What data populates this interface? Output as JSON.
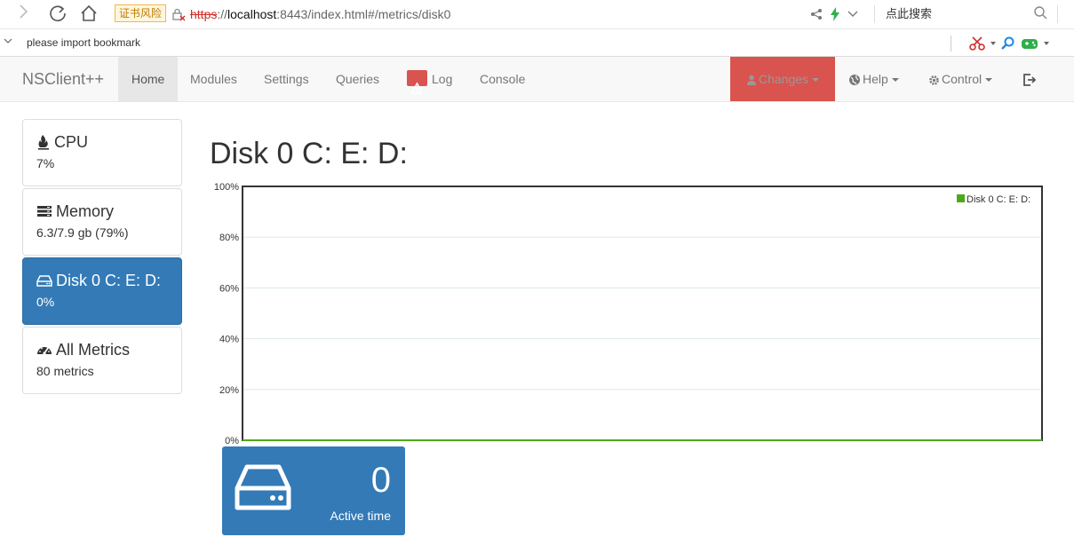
{
  "browser": {
    "risk_badge": "证书风险",
    "url_scheme": "https",
    "url_sep": "://",
    "url_host": "localhost",
    "url_rest": ":8443/index.html#/metrics/disk0",
    "search_placeholder": "点此搜索",
    "bookmark_text": "please import bookmark"
  },
  "navbar": {
    "brand": "NSClient++",
    "items": [
      {
        "label": "Home"
      },
      {
        "label": "Modules"
      },
      {
        "label": "Settings"
      },
      {
        "label": "Queries"
      },
      {
        "label": "Log"
      },
      {
        "label": "Console"
      }
    ],
    "changes": "Changes",
    "help": "Help",
    "control": "Control"
  },
  "sidebar": {
    "items": [
      {
        "title": "CPU",
        "value": "7%",
        "icon": "fire-icon"
      },
      {
        "title": "Memory",
        "value": "6.3/7.9 gb (79%)",
        "icon": "memory-icon"
      },
      {
        "title": "Disk 0 C: E: D:",
        "value": "0%",
        "icon": "hdd-icon"
      },
      {
        "title": "All Metrics",
        "value": "80 metrics",
        "icon": "dashboard-icon"
      }
    ]
  },
  "main": {
    "title": "Disk 0 C: E: D:"
  },
  "stat": {
    "value": "0",
    "label": "Active time"
  },
  "colors": {
    "series": "#4caa17",
    "accent": "#337ab7",
    "danger": "#d9534f"
  },
  "chart_data": {
    "type": "line",
    "title": "",
    "xlabel": "",
    "ylabel": "",
    "ylim": [
      0,
      100
    ],
    "y_ticks": [
      "0%",
      "20%",
      "40%",
      "60%",
      "80%",
      "100%"
    ],
    "legend_position": "top-right",
    "series": [
      {
        "name": "Disk 0 C: E: D:",
        "values": [
          0,
          0
        ]
      }
    ]
  }
}
